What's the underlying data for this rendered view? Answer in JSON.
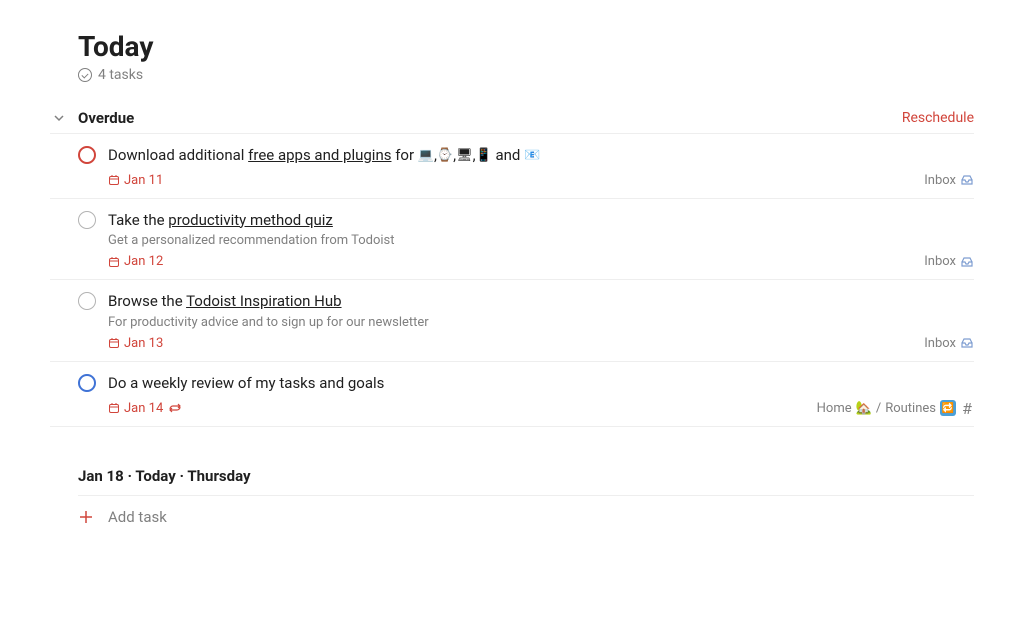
{
  "header": {
    "title": "Today",
    "task_count": "4 tasks"
  },
  "overdue_section": {
    "title": "Overdue",
    "reschedule_label": "Reschedule"
  },
  "tasks": [
    {
      "title_pre": "Download additional ",
      "title_underline": "free apps and plugins",
      "title_mid": " for ",
      "title_tail": " and ",
      "date": "Jan 11",
      "project": "Inbox",
      "priority": "red",
      "description": ""
    },
    {
      "title_pre": "Take the ",
      "title_underline": "productivity method quiz",
      "title_mid": "",
      "title_tail": "",
      "description": "Get a personalized recommendation from Todoist",
      "date": "Jan 12",
      "project": "Inbox",
      "priority": "gray"
    },
    {
      "title_pre": "Browse the ",
      "title_underline": "Todoist Inspiration Hub",
      "title_mid": "",
      "title_tail": "",
      "description": "For productivity advice and to sign up for our newsletter",
      "date": "Jan 13",
      "project": "Inbox",
      "priority": "gray"
    },
    {
      "title_pre": "Do a weekly review of my tasks and goals",
      "title_underline": "",
      "title_mid": "",
      "title_tail": "",
      "description": "",
      "date": "Jan 14",
      "project_path_1": "Home ",
      "project_path_sep": " / ",
      "project_path_2": "Routines ",
      "priority": "blue",
      "recurring": true
    }
  ],
  "today_section": {
    "header": "Jan 18 · Today · Thursday",
    "add_task_label": "Add task"
  }
}
